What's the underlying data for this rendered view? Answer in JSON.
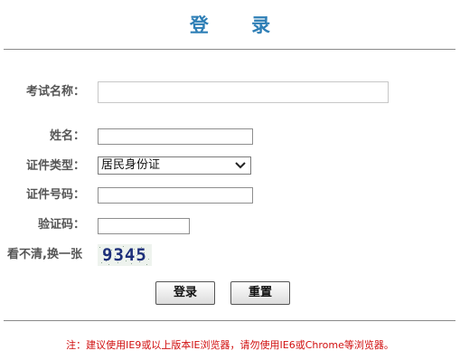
{
  "header": {
    "title": "登 录"
  },
  "form": {
    "exam_name": {
      "label": "考试名称：",
      "value": ""
    },
    "name": {
      "label": "姓名：",
      "value": ""
    },
    "id_type": {
      "label": "证件类型：",
      "selected": "居民身份证"
    },
    "id_number": {
      "label": "证件号码：",
      "value": ""
    },
    "captcha": {
      "label": "验证码：",
      "value": ""
    },
    "refresh_text": "看不清,换一张",
    "captcha_code": "9345"
  },
  "buttons": {
    "login": "登录",
    "reset": "重置"
  },
  "footer": {
    "note": "注：建议使用IE9或以上版本IE浏览器，请勿使用IE6或Chrome等浏览器。"
  },
  "colors": {
    "title": "#2f7fb6",
    "note": "#d11010"
  }
}
